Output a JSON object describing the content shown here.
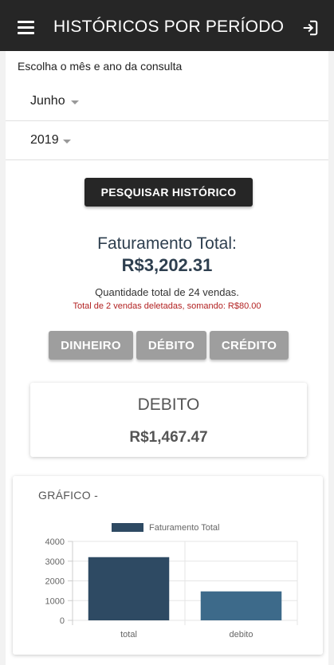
{
  "header": {
    "title": "HISTÓRICOS POR PERÍODO",
    "menu_icon": "menu-icon",
    "logout_icon": "logout-icon"
  },
  "filters": {
    "prompt": "Escolha o mês e ano da consulta",
    "month": "Junho",
    "year": "2019"
  },
  "search_button": "PESQUISAR HISTÓRICO",
  "summary": {
    "label": "Faturamento Total:",
    "value": "R$3,202.31",
    "quantity_text": "Quantidade total de 24 vendas.",
    "deleted_text": "Total de 2 vendas deletadas, somando: R$80.00"
  },
  "payment_buttons": {
    "dinheiro": "DINHEIRO",
    "debito": "DÉBITO",
    "credito": "CRÉDITO"
  },
  "selected_card": {
    "title": "DEBITO",
    "value": "R$1,467.47"
  },
  "chart_title": "GRÁFICO -",
  "colors": {
    "topbar": "#262626",
    "bar_total": "#2e4a63",
    "bar_debito": "#3d6a8a",
    "button_gray": "#9e9e9e"
  },
  "chart_data": {
    "type": "bar",
    "categories": [
      "total",
      "debito"
    ],
    "series": [
      {
        "name": "Faturamento Total",
        "values": [
          3202.31,
          1467.47
        ]
      }
    ],
    "yticks": [
      0,
      1000,
      2000,
      3000,
      4000
    ],
    "ylim": [
      0,
      4000
    ],
    "legend": "top",
    "grid": true
  }
}
